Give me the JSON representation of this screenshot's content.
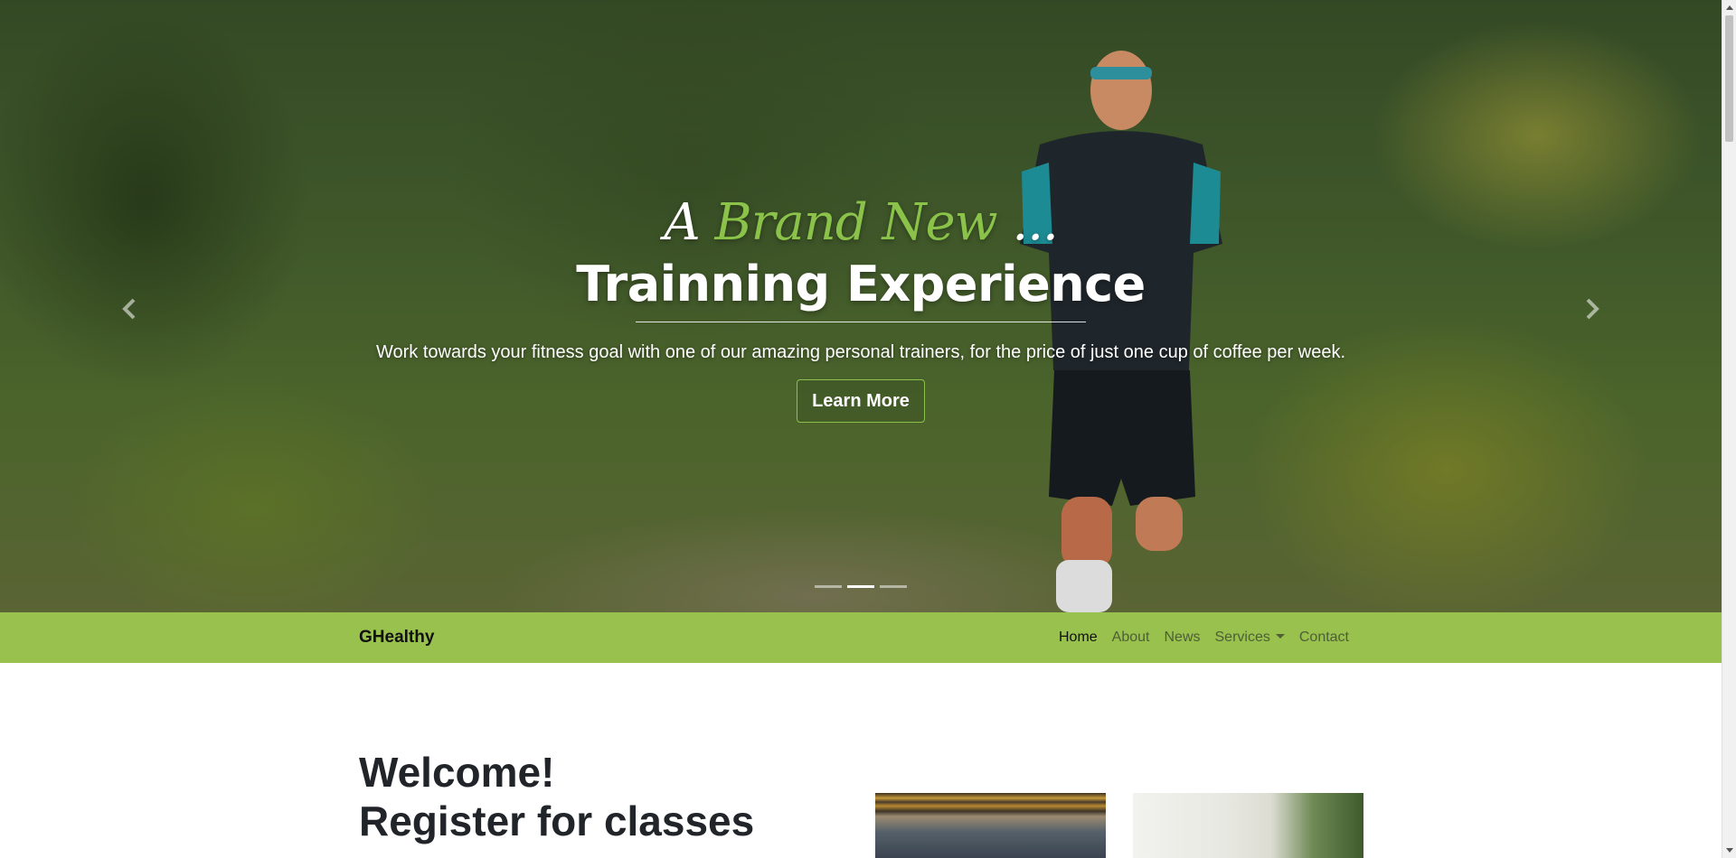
{
  "hero": {
    "script_prefix": "A",
    "script_accent": "Brand New",
    "script_suffix": "...",
    "title": "Trainning Experience",
    "text": "Work towards your fitness goal with one of our amazing personal trainers, for the price of just one cup of coffee per week.",
    "button_label": "Learn More",
    "prev_icon": "chevron-left-icon",
    "next_icon": "chevron-right-icon",
    "slides_total": 3,
    "active_slide": 2
  },
  "navbar": {
    "brand": "GHealthy",
    "links": [
      {
        "label": "Home",
        "active": true
      },
      {
        "label": "About",
        "active": false
      },
      {
        "label": "News",
        "active": false
      },
      {
        "label": "Services",
        "active": false,
        "dropdown": true
      },
      {
        "label": "Contact",
        "active": false
      }
    ]
  },
  "main": {
    "welcome_line1": "Welcome!",
    "welcome_line2": "Register for classes"
  },
  "colors": {
    "accent": "#8bc34a",
    "navbar_bg": "#99c14d",
    "nav_link": "#4e5e37",
    "nav_link_active": "#111111"
  }
}
